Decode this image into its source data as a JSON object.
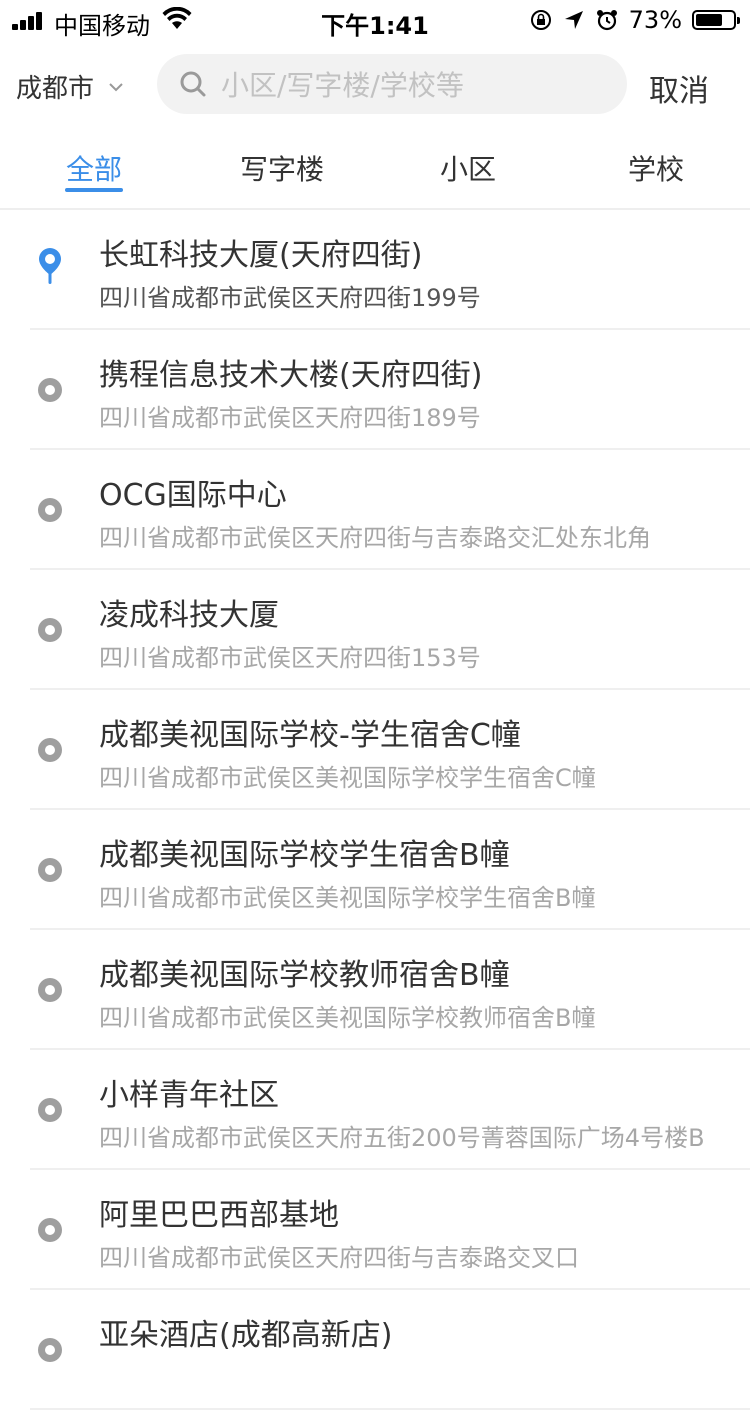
{
  "status_bar": {
    "carrier": "中国移动",
    "time": "下午1:41",
    "battery_percent": "73%",
    "battery_level": 0.73
  },
  "search": {
    "city": "成都市",
    "placeholder": "小区/写字楼/学校等",
    "value": "",
    "cancel_label": "取消"
  },
  "tabs": [
    {
      "label": "全部",
      "active": true
    },
    {
      "label": "写字楼",
      "active": false
    },
    {
      "label": "小区",
      "active": false
    },
    {
      "label": "学校",
      "active": false
    }
  ],
  "accent_color": "#3b8ee8",
  "places": [
    {
      "name": "长虹科技大厦(天府四街)",
      "address": "四川省成都市武侯区天府四街199号",
      "selected": true,
      "icon": "location-pin-icon"
    },
    {
      "name": "携程信息技术大楼(天府四街)",
      "address": "四川省成都市武侯区天府四街189号",
      "selected": false,
      "icon": "radio-dot-icon"
    },
    {
      "name": "OCG国际中心",
      "address": "四川省成都市武侯区天府四街与吉泰路交汇处东北角",
      "selected": false,
      "icon": "radio-dot-icon"
    },
    {
      "name": "凌成科技大厦",
      "address": "四川省成都市武侯区天府四街153号",
      "selected": false,
      "icon": "radio-dot-icon"
    },
    {
      "name": "成都美视国际学校-学生宿舍C幢",
      "address": "四川省成都市武侯区美视国际学校学生宿舍C幢",
      "selected": false,
      "icon": "radio-dot-icon"
    },
    {
      "name": "成都美视国际学校学生宿舍B幢",
      "address": "四川省成都市武侯区美视国际学校学生宿舍B幢",
      "selected": false,
      "icon": "radio-dot-icon"
    },
    {
      "name": "成都美视国际学校教师宿舍B幢",
      "address": "四川省成都市武侯区美视国际学校教师宿舍B幢",
      "selected": false,
      "icon": "radio-dot-icon"
    },
    {
      "name": "小样青年社区",
      "address": "四川省成都市武侯区天府五街200号菁蓉国际广场4号楼B",
      "selected": false,
      "icon": "radio-dot-icon"
    },
    {
      "name": "阿里巴巴西部基地",
      "address": "四川省成都市武侯区天府四街与吉泰路交叉口",
      "selected": false,
      "icon": "radio-dot-icon"
    },
    {
      "name": "亚朵酒店(成都高新店)",
      "address": "",
      "selected": false,
      "icon": "radio-dot-icon"
    }
  ]
}
